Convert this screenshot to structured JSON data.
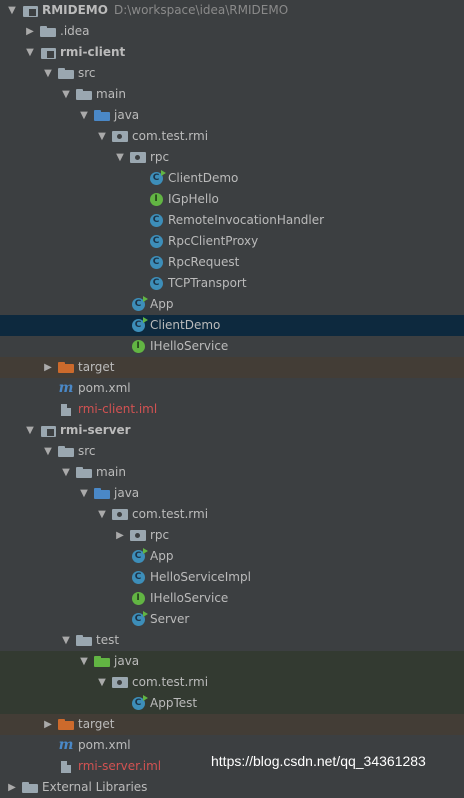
{
  "project": {
    "name": "RMIDEMO",
    "path": "D:\\workspace\\idea\\RMIDEMO"
  },
  "tree": [
    {
      "depth": 0,
      "arrow": "down",
      "icon": "module",
      "label": "RMIDEMO",
      "style": "bold",
      "path": "D:\\workspace\\idea\\RMIDEMO"
    },
    {
      "depth": 1,
      "arrow": "right",
      "icon": "folder-grey",
      "label": ".idea"
    },
    {
      "depth": 1,
      "arrow": "down",
      "icon": "module",
      "label": "rmi-client",
      "style": "bold"
    },
    {
      "depth": 2,
      "arrow": "down",
      "icon": "folder-grey",
      "label": "src"
    },
    {
      "depth": 3,
      "arrow": "down",
      "icon": "folder-grey",
      "label": "main"
    },
    {
      "depth": 4,
      "arrow": "down",
      "icon": "folder-blue",
      "label": "java"
    },
    {
      "depth": 5,
      "arrow": "down",
      "icon": "package",
      "label": "com.test.rmi"
    },
    {
      "depth": 6,
      "arrow": "down",
      "icon": "package",
      "label": "rpc"
    },
    {
      "depth": 7,
      "arrow": "none",
      "icon": "class-main",
      "label": "ClientDemo"
    },
    {
      "depth": 7,
      "arrow": "none",
      "icon": "interface",
      "label": "IGpHello"
    },
    {
      "depth": 7,
      "arrow": "none",
      "icon": "class",
      "label": "RemoteInvocationHandler"
    },
    {
      "depth": 7,
      "arrow": "none",
      "icon": "class",
      "label": "RpcClientProxy"
    },
    {
      "depth": 7,
      "arrow": "none",
      "icon": "class",
      "label": "RpcRequest"
    },
    {
      "depth": 7,
      "arrow": "none",
      "icon": "class",
      "label": "TCPTransport"
    },
    {
      "depth": 6,
      "arrow": "none",
      "icon": "class-main",
      "label": "App"
    },
    {
      "depth": 6,
      "arrow": "none",
      "icon": "class-main",
      "label": "ClientDemo",
      "selected": true
    },
    {
      "depth": 6,
      "arrow": "none",
      "icon": "interface",
      "label": "IHelloService"
    },
    {
      "depth": 2,
      "arrow": "right",
      "icon": "folder-orange",
      "label": "target",
      "bg": "target"
    },
    {
      "depth": 2,
      "arrow": "none",
      "icon": "maven",
      "label": "pom.xml"
    },
    {
      "depth": 2,
      "arrow": "none",
      "icon": "iml",
      "label": "rmi-client.iml",
      "style": "iml"
    },
    {
      "depth": 1,
      "arrow": "down",
      "icon": "module",
      "label": "rmi-server",
      "style": "bold"
    },
    {
      "depth": 2,
      "arrow": "down",
      "icon": "folder-grey",
      "label": "src"
    },
    {
      "depth": 3,
      "arrow": "down",
      "icon": "folder-grey",
      "label": "main"
    },
    {
      "depth": 4,
      "arrow": "down",
      "icon": "folder-blue",
      "label": "java"
    },
    {
      "depth": 5,
      "arrow": "down",
      "icon": "package",
      "label": "com.test.rmi"
    },
    {
      "depth": 6,
      "arrow": "right",
      "icon": "package",
      "label": "rpc"
    },
    {
      "depth": 6,
      "arrow": "none",
      "icon": "class-main",
      "label": "App"
    },
    {
      "depth": 6,
      "arrow": "none",
      "icon": "class",
      "label": "HelloServiceImpl"
    },
    {
      "depth": 6,
      "arrow": "none",
      "icon": "interface",
      "label": "IHelloService"
    },
    {
      "depth": 6,
      "arrow": "none",
      "icon": "class-main",
      "label": "Server"
    },
    {
      "depth": 3,
      "arrow": "down",
      "icon": "folder-grey",
      "label": "test"
    },
    {
      "depth": 4,
      "arrow": "down",
      "icon": "folder-green",
      "label": "java",
      "bg": "test"
    },
    {
      "depth": 5,
      "arrow": "down",
      "icon": "package",
      "label": "com.test.rmi",
      "bg": "test"
    },
    {
      "depth": 6,
      "arrow": "none",
      "icon": "class-main",
      "label": "AppTest",
      "bg": "test"
    },
    {
      "depth": 2,
      "arrow": "right",
      "icon": "folder-orange",
      "label": "target",
      "bg": "target"
    },
    {
      "depth": 2,
      "arrow": "none",
      "icon": "maven",
      "label": "pom.xml"
    },
    {
      "depth": 2,
      "arrow": "none",
      "icon": "iml",
      "label": "rmi-server.iml",
      "style": "iml"
    },
    {
      "depth": 0,
      "arrow": "right",
      "icon": "folder-grey",
      "label": "External Libraries"
    }
  ],
  "watermark": "https://blog.csdn.net/qq_34361283",
  "colors": {
    "background": "#3c3f41",
    "selection": "#0d293e",
    "target_bg": "#433d36",
    "test_bg": "#333a31",
    "iml_text": "#d25252"
  }
}
